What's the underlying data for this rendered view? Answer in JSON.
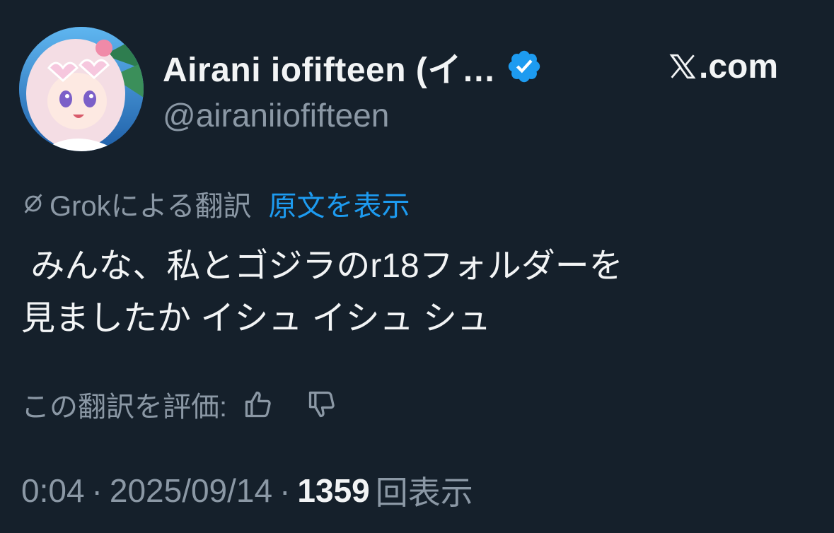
{
  "post": {
    "author": {
      "display_name": "Airani iofifteen (イ…",
      "handle": "@airaniiofifteen",
      "verified_icon": "verified-badge-icon",
      "avatar": "avatar-image"
    },
    "site": {
      "logo_icon": "x-logo-icon",
      "label": ".com"
    },
    "translation": {
      "icon": "grok-icon",
      "translated_by": "Grokによる翻訳",
      "show_original": "原文を表示"
    },
    "text": " みんな、私とゴジラのr18フォルダーを\n見ましたか イシュ イシュ シュ",
    "rate": {
      "label": "この翻訳を評価:",
      "thumbs_up_icon": "thumbs-up-icon",
      "thumbs_down_icon": "thumbs-down-icon"
    },
    "meta": {
      "time": "0:04",
      "separator": "·",
      "date": "2025/09/14",
      "views_count": "1359",
      "views_label": "回表示"
    }
  },
  "colors": {
    "background": "#15202b",
    "primary_text": "#f2f4f5",
    "secondary_text": "#8b98a5",
    "link": "#1d9bf0",
    "verified": "#1d9bf0"
  }
}
